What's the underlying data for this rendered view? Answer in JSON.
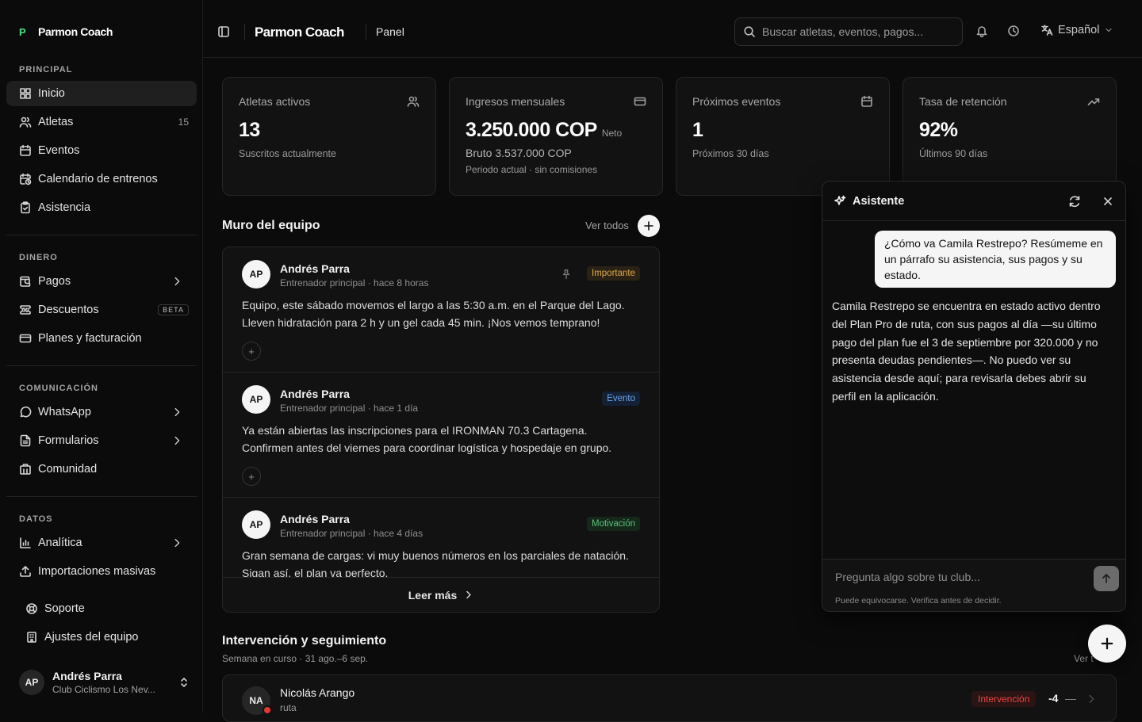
{
  "brand": {
    "mark": "P",
    "name": "Parmon Coach"
  },
  "sidebar": {
    "principal": {
      "title": "PRINCIPAL",
      "items": [
        {
          "label": "Inicio"
        },
        {
          "label": "Atletas",
          "count": "15"
        },
        {
          "label": "Eventos"
        },
        {
          "label": "Calendario de entrenos"
        },
        {
          "label": "Asistencia"
        }
      ]
    },
    "dinero": {
      "title": "DINERO",
      "items": [
        {
          "label": "Pagos"
        },
        {
          "label": "Descuentos",
          "badge": "BETA"
        },
        {
          "label": "Planes y facturación"
        }
      ]
    },
    "comunicacion": {
      "title": "COMUNICACIÓN",
      "items": [
        {
          "label": "WhatsApp"
        },
        {
          "label": "Formularios"
        },
        {
          "label": "Comunidad"
        }
      ]
    },
    "datos": {
      "title": "DATOS",
      "items": [
        {
          "label": "Analítica"
        },
        {
          "label": "Importaciones masivas"
        }
      ]
    },
    "footer": {
      "items": [
        {
          "label": "Soporte"
        },
        {
          "label": "Ajustes del equipo"
        }
      ]
    },
    "user": {
      "initials": "AP",
      "name": "Andrés Parra",
      "club": "Club Ciclismo Los Nev..."
    }
  },
  "header": {
    "brand": "Parmon Coach",
    "page": "Panel",
    "search_placeholder": "Buscar atletas, eventos, pagos...",
    "language": "Español"
  },
  "stats": [
    {
      "title": "Atletas activos",
      "value": "13",
      "sub": "Suscritos actualmente"
    },
    {
      "title": "Ingresos mensuales",
      "value": "3.250.000 COP",
      "value_note": "Neto",
      "sub2": "Bruto 3.537.000 COP",
      "sub3": "Periodo actual · sin comisiones"
    },
    {
      "title": "Próximos eventos",
      "value": "1",
      "sub": "Próximos 30 días"
    },
    {
      "title": "Tasa de retención",
      "value": "92%",
      "sub": "Últimos 90 días"
    }
  ],
  "wall": {
    "title": "Muro del equipo",
    "see_all": "Ver todos",
    "read_more": "Leer más",
    "posts": [
      {
        "initials": "AP",
        "author": "Andrés Parra",
        "meta": "Entrenador principal · hace 8 horas",
        "tag": "Importante",
        "body": "Equipo, este sábado movemos el largo a las 5:30 a.m. en el Parque del Lago. Lleven hidratación para 2 h y un gel cada 45 min. ¡Nos vemos temprano!",
        "react": "+"
      },
      {
        "initials": "AP",
        "author": "Andrés Parra",
        "meta": "Entrenador principal · hace 1 día",
        "tag": "Evento",
        "body": "Ya están abiertas las inscripciones para el IRONMAN 70.3 Cartagena. Confirmen antes del viernes para coordinar logística y hospedaje en grupo.",
        "react": "+"
      },
      {
        "initials": "AP",
        "author": "Andrés Parra",
        "meta": "Entrenador principal · hace 4 días",
        "tag": "Motivación",
        "body": "Gran semana de cargas: vi muy buenos números en los parciales de natación. Sigan así, el plan va perfecto."
      }
    ]
  },
  "intervention": {
    "title": "Intervención y seguimiento",
    "sub": "Semana en curso · 31 ago.–6 sep.",
    "see_all": "Ver t",
    "rows": [
      {
        "initials": "NA",
        "name": "Nicolás Arango",
        "plan": "ruta",
        "tag": "Intervención",
        "score": "-4",
        "trend": "—"
      }
    ]
  },
  "assistant": {
    "title": "Asistente",
    "question": "¿Cómo va Camila Restrepo? Resúmeme en un párrafo su asistencia, sus pagos y su estado.",
    "answer": "Camila Restrepo se encuentra en estado activo dentro del Plan Pro de ruta, con sus pagos al día —su último pago del plan fue el 3 de septiembre por 320.000 y no presenta deudas pendientes—. No puedo ver su asistencia desde aquí; para revisarla debes abrir su perfil en la aplicación.",
    "input_placeholder": "Pregunta algo sobre tu club...",
    "disclaimer": "Puede equivocarse. Verifica antes de decidir."
  },
  "colors": {
    "tag_important": "#e0a84a",
    "tag_event": "#6ba4ea",
    "tag_motivation": "#59c27a",
    "tag_intervention": "#ef4444"
  }
}
